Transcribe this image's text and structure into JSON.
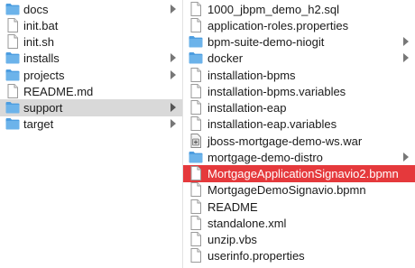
{
  "left_column": [
    {
      "name": "docs",
      "type": "folder",
      "chevron": true
    },
    {
      "name": "init.bat",
      "type": "file",
      "chevron": false
    },
    {
      "name": "init.sh",
      "type": "file",
      "chevron": false
    },
    {
      "name": "installs",
      "type": "folder",
      "chevron": true
    },
    {
      "name": "projects",
      "type": "folder",
      "chevron": true
    },
    {
      "name": "README.md",
      "type": "file",
      "chevron": false
    },
    {
      "name": "support",
      "type": "folder",
      "chevron": true,
      "selected": true
    },
    {
      "name": "target",
      "type": "folder",
      "chevron": true
    }
  ],
  "right_column": [
    {
      "name": "1000_jbpm_demo_h2.sql",
      "type": "file",
      "chevron": false
    },
    {
      "name": "application-roles.properties",
      "type": "file",
      "chevron": false
    },
    {
      "name": "bpm-suite-demo-niogit",
      "type": "folder",
      "chevron": true
    },
    {
      "name": "docker",
      "type": "folder",
      "chevron": true
    },
    {
      "name": "installation-bpms",
      "type": "file",
      "chevron": false
    },
    {
      "name": "installation-bpms.variables",
      "type": "file",
      "chevron": false
    },
    {
      "name": "installation-eap",
      "type": "file",
      "chevron": false
    },
    {
      "name": "installation-eap.variables",
      "type": "file",
      "chevron": false
    },
    {
      "name": "jboss-mortgage-demo-ws.war",
      "type": "war",
      "chevron": false
    },
    {
      "name": "mortgage-demo-distro",
      "type": "folder",
      "chevron": true
    },
    {
      "name": "MortgageApplicationSignavio2.bpmn",
      "type": "file",
      "chevron": false,
      "selected": true
    },
    {
      "name": "MortgageDemoSignavio.bpmn",
      "type": "file",
      "chevron": false
    },
    {
      "name": "README",
      "type": "file",
      "chevron": false
    },
    {
      "name": "standalone.xml",
      "type": "file",
      "chevron": false
    },
    {
      "name": "unzip.vbs",
      "type": "file",
      "chevron": false
    },
    {
      "name": "userinfo.properties",
      "type": "file",
      "chevron": false
    }
  ],
  "colors": {
    "folder": "#6cb3ea",
    "folder_dark": "#4c9de0",
    "selected_red": "#e5393c",
    "selected_gray": "#d9d9d9"
  }
}
